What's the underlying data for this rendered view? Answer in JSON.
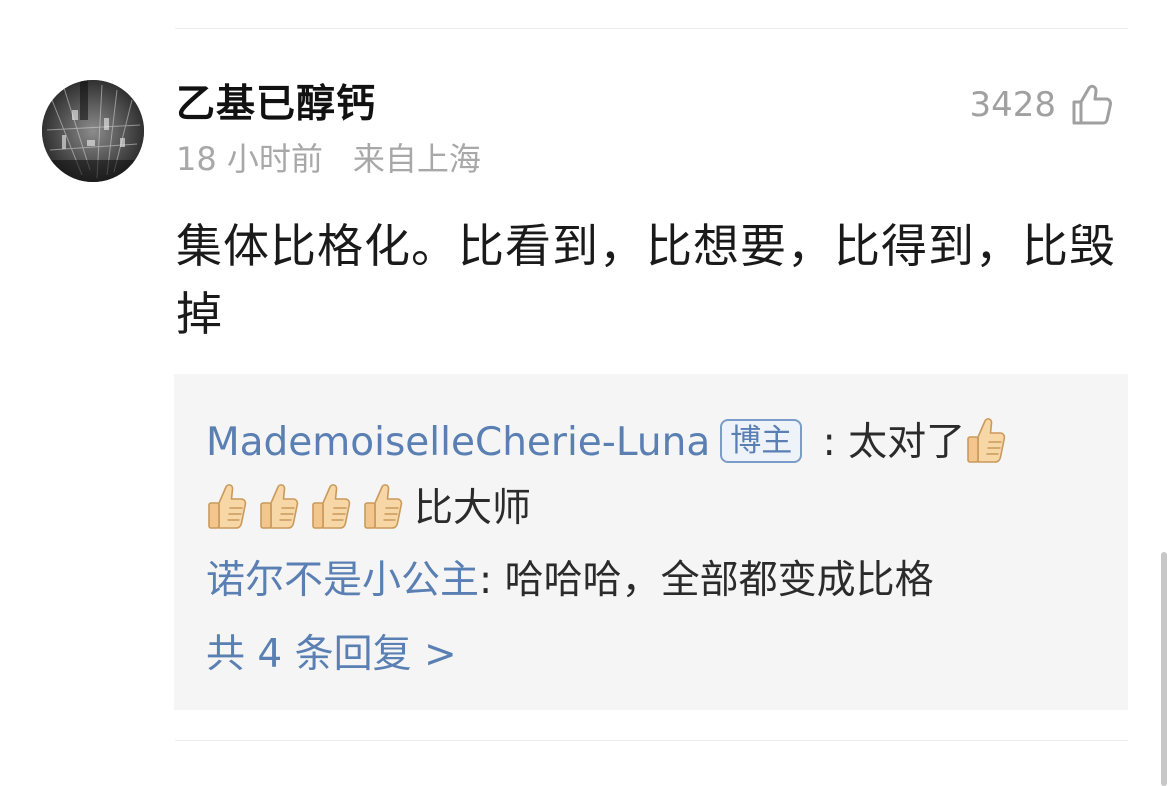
{
  "comment": {
    "username": "乙基已醇钙",
    "time": "18 小时前",
    "location": "来自上海",
    "like_count": "3428",
    "like_icon": "thumbs-up-outline-icon",
    "content": "集体比格化。比看到，比想要，比得到，比毁掉"
  },
  "replies": [
    {
      "name": "MademoiselleCherie-Luna",
      "badge": "博主",
      "separator": " : ",
      "text": "太对了",
      "thumb_icon": "thumbs-up-emoji-icon",
      "thumb_count_line1": 1,
      "thumb_count_line2": 4,
      "text_after": "比大师"
    },
    {
      "name": "诺尔不是小公主",
      "separator": ": ",
      "text": "哈哈哈，全部都变成比格"
    }
  ],
  "more_replies": "共 4 条回复 >",
  "colors": {
    "link": "#5a7fb3",
    "meta": "#a8a8a8",
    "reply_bg": "#f5f5f5"
  }
}
